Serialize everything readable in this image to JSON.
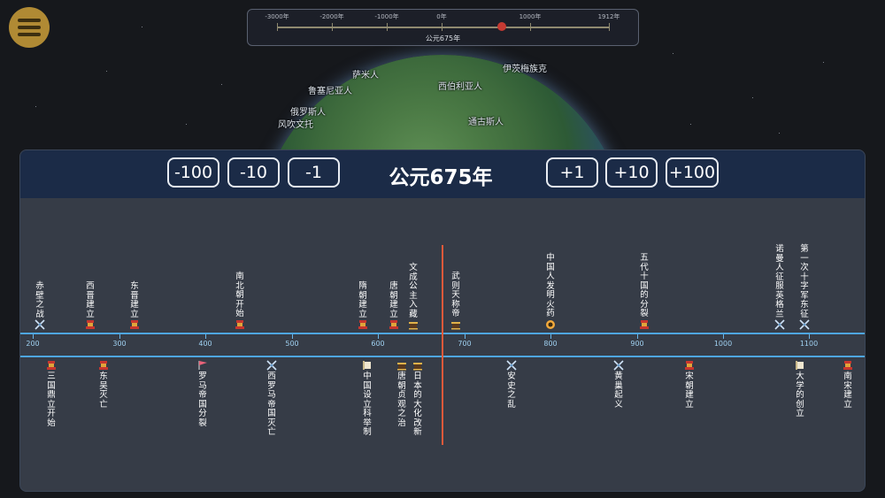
{
  "era_slider": {
    "ticks": [
      "-3000年",
      "-2000年",
      "-1000年",
      "0年",
      "1000年",
      "1912年"
    ],
    "current_label": "公元675年"
  },
  "globe_labels": [
    "萨米人",
    "鲁塞尼亚人",
    "西伯利亚人",
    "伊茨梅族克",
    "俄罗斯人",
    "风吹文托",
    "通古斯人"
  ],
  "header": {
    "minus_buttons": [
      "-100",
      "-10",
      "-1"
    ],
    "title": "公元675年",
    "plus_buttons": [
      "+1",
      "+10",
      "+100"
    ]
  },
  "axis_labels": [
    "200",
    "300",
    "400",
    "500",
    "600",
    "700",
    "800",
    "900",
    "1000",
    "1100"
  ],
  "events_top": [
    {
      "text": "赤壁之战",
      "icon": "crossed-swords-icon"
    },
    {
      "text": "西晋建立",
      "icon": "pagoda-icon"
    },
    {
      "text": "东晋建立",
      "icon": "pagoda-icon"
    },
    {
      "text": "南北朝开始",
      "icon": "pagoda-icon"
    },
    {
      "text": "隋朝建立",
      "icon": "pagoda-icon"
    },
    {
      "text": "唐朝建立",
      "icon": "pagoda-icon"
    },
    {
      "text": "文成公主入藏",
      "icon": "palace-icon"
    },
    {
      "text": "武则天称帝",
      "icon": "palace-icon"
    },
    {
      "text": "中国人发明火药",
      "icon": "explosion-icon"
    },
    {
      "text": "五代十国的分裂",
      "icon": "pagoda-icon"
    },
    {
      "text": "诺曼人征服英格兰",
      "icon": "crossed-swords-icon"
    },
    {
      "text": "第一次十字军东征",
      "icon": "crossed-swords-icon"
    }
  ],
  "events_bottom": [
    {
      "text": "三国鼎立开始",
      "icon": "pagoda-icon"
    },
    {
      "text": "东吴灭亡",
      "icon": "pagoda-icon"
    },
    {
      "text": "罗马帝国分裂",
      "icon": "flag-icon"
    },
    {
      "text": "西罗马帝国灭亡",
      "icon": "crossed-swords-icon"
    },
    {
      "text": "中国设立科举制",
      "icon": "scroll-icon"
    },
    {
      "text": "唐朝贞观之治",
      "icon": "palace-icon"
    },
    {
      "text": "日本的大化改新",
      "icon": "palace-icon"
    },
    {
      "text": "安史之乱",
      "icon": "crossed-swords-icon"
    },
    {
      "text": "黄巢起义",
      "icon": "crossed-swords-icon"
    },
    {
      "text": "宋朝建立",
      "icon": "pagoda-icon"
    },
    {
      "text": "大学的创立",
      "icon": "scroll-icon"
    },
    {
      "text": "南宋建立",
      "icon": "pagoda-icon"
    }
  ],
  "colors": {
    "accent": "#e2593a",
    "axis": "#4ea6e0",
    "header": "#1b2b47",
    "panel": "#363c47",
    "menu": "#b08a34"
  }
}
